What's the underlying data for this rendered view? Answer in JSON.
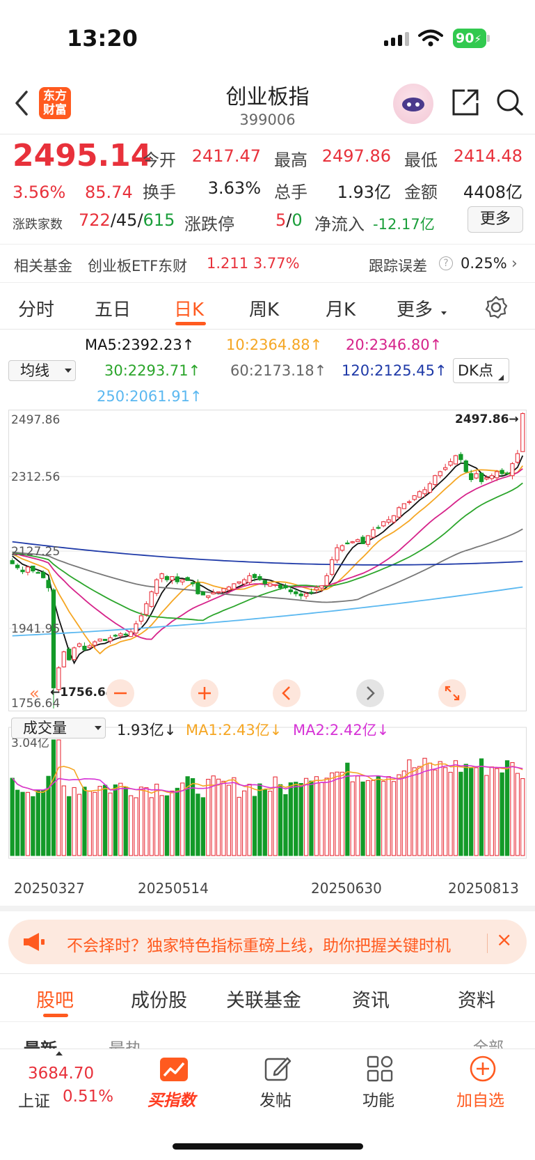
{
  "status_bar": {
    "time": "13:20",
    "battery": "90"
  },
  "header": {
    "logo_line1": "东方",
    "logo_line2": "财富",
    "title": "创业板指",
    "code": "399006"
  },
  "quote": {
    "price": "2495.14",
    "change_pct": "3.56%",
    "change": "85.74",
    "open_label": "今开",
    "open": "2417.47",
    "high_label": "最高",
    "high": "2497.86",
    "low_label": "最低",
    "low": "2414.48",
    "turnover_label": "换手",
    "turnover": "3.63%",
    "volume_label": "总手",
    "volume": "1.93亿",
    "amount_label": "金额",
    "amount": "4408亿",
    "updown_label": "涨跌家数",
    "up_count": "722",
    "flat_count": "45",
    "down_count": "615",
    "limit_label": "涨跌停",
    "limit_up": "5",
    "limit_down": "0",
    "netflow_label": "净流入",
    "netflow": "-12.17亿",
    "more_button": "更多"
  },
  "fund": {
    "label": "相关基金",
    "name": "创业板ETF东财",
    "price": "1.211",
    "pct": "3.77%",
    "track_label": "跟踪误差",
    "track_value": "0.25%"
  },
  "tabs": [
    "分时",
    "五日",
    "日K",
    "周K",
    "月K",
    "更多"
  ],
  "active_tab": "日K",
  "indicators": {
    "ma_select": "均线",
    "dk_select": "DK点",
    "ma5": "MA5:2392.23↑",
    "ma10": "10:2364.88↑",
    "ma20": "20:2346.80↑",
    "ma30": "30:2293.71↑",
    "ma60": "60:2173.18↑",
    "ma120": "120:2125.45↑",
    "ma250": "250:2061.91↑",
    "colors": {
      "ma5": "#111111",
      "ma10": "#f5a623",
      "ma20": "#d6238a",
      "ma30": "#2ba52b",
      "ma60": "#777777",
      "ma120": "#1f3aa8",
      "ma250": "#5bb8f0"
    }
  },
  "chart_labels": {
    "y_top": "2497.86",
    "y_upper": "2312.56",
    "y_mid": "2127.25",
    "y_lower": "1941.95",
    "y_bottom": "1756.64",
    "high_marker": "2497.86→",
    "low_marker": "←1756.64"
  },
  "volume": {
    "select": "成交量",
    "current": "1.93亿↓",
    "ma1": "MA1:2.43亿↓",
    "ma2": "MA2:2.42亿↓",
    "y_top": "3.04亿",
    "colors": {
      "ma1": "#f5a623",
      "ma2": "#d633d6"
    }
  },
  "dates": [
    "20250327",
    "20250514",
    "20250630",
    "20250813"
  ],
  "banner": {
    "text": "不会择时？独家特色指标重磅上线，助你把握关键时机"
  },
  "bottom_tabs": [
    "股吧",
    "成份股",
    "关联基金",
    "资讯",
    "资料"
  ],
  "bottom_subtabs": {
    "latest": "最新",
    "hot": "最热",
    "all": "全部"
  },
  "bottom_nav": {
    "market_price": "3684.70",
    "market_name": "上证",
    "market_pct": "0.51%",
    "buy_index": "买指数",
    "post": "发帖",
    "features": "功能",
    "add_watch": "加自选"
  },
  "chart_data": {
    "type": "candlestick",
    "title": "",
    "x_ticks": [
      "20250327",
      "20250514",
      "20250630",
      "20250813"
    ],
    "ylim": [
      1756.64,
      2497.86
    ],
    "y_ticks": [
      2497.86,
      2312.56,
      2127.25,
      1941.95,
      1756.64
    ],
    "n_days": 100,
    "high_label": 2497.86,
    "low_label": 1756.64,
    "close": [
      2120,
      2110,
      2100,
      2112,
      2102,
      2098,
      2085,
      2060,
      1810,
      1860,
      1900,
      1880,
      1910,
      1920,
      1905,
      1915,
      1925,
      1932,
      1928,
      1935,
      1940,
      1945,
      1942,
      1950,
      1970,
      1990,
      2020,
      2050,
      2080,
      2095,
      2080,
      2088,
      2075,
      2080,
      2078,
      2070,
      2045,
      2042,
      2040,
      2048,
      2050,
      2058,
      2062,
      2070,
      2075,
      2080,
      2090,
      2085,
      2080,
      2070,
      2070,
      2068,
      2060,
      2060,
      2050,
      2045,
      2040,
      2045,
      2048,
      2060,
      2065,
      2090,
      2130,
      2160,
      2165,
      2170,
      2175,
      2180,
      2170,
      2190,
      2205,
      2210,
      2225,
      2230,
      2240,
      2260,
      2270,
      2275,
      2290,
      2300,
      2305,
      2320,
      2340,
      2350,
      2360,
      2375,
      2390,
      2380,
      2350,
      2330,
      2345,
      2325,
      2335,
      2340,
      2350,
      2345,
      2345,
      2370,
      2395,
      2495.14
    ],
    "series": [
      {
        "name": "MA5",
        "last": 2392.23
      },
      {
        "name": "10",
        "last": 2364.88
      },
      {
        "name": "20",
        "last": 2346.8
      },
      {
        "name": "30",
        "last": 2293.71
      },
      {
        "name": "60",
        "last": 2173.18
      },
      {
        "name": "120",
        "last": 2125.45
      },
      {
        "name": "250",
        "last": 2061.91
      }
    ],
    "volume_ylim": [
      0,
      3.04
    ],
    "volume_last": 1.93,
    "volume_ma1_last": 2.43,
    "volume_ma2_last": 2.42
  }
}
